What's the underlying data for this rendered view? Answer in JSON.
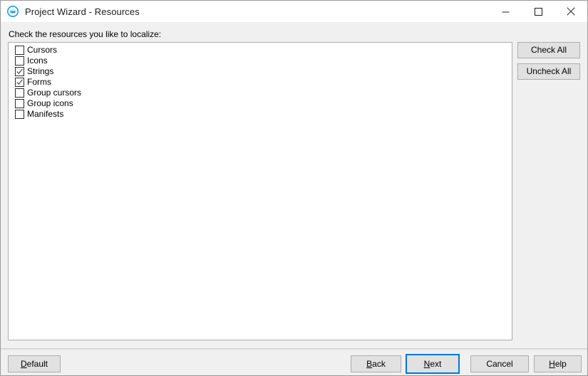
{
  "window": {
    "title": "Project Wizard - Resources",
    "icon": "project-wizard-icon",
    "controls": {
      "minimize": "minimize-icon",
      "maximize": "maximize-icon",
      "close": "close-icon"
    }
  },
  "colors": {
    "accent": "#0078d7",
    "window_body": "#f0f0f0",
    "titlebar": "#ffffff",
    "button_face": "#e1e1e1",
    "button_border": "#adadad",
    "listbox_border": "#adadad",
    "text": "#000000"
  },
  "main": {
    "instruction": "Check the resources you like to localize:",
    "resources": [
      {
        "label": "Cursors",
        "checked": false
      },
      {
        "label": "Icons",
        "checked": false
      },
      {
        "label": "Strings",
        "checked": true
      },
      {
        "label": "Forms",
        "checked": true
      },
      {
        "label": "Group cursors",
        "checked": false
      },
      {
        "label": "Group icons",
        "checked": false
      },
      {
        "label": "Manifests",
        "checked": false
      }
    ]
  },
  "side_buttons": [
    {
      "label": "Check All",
      "name": "check-all-button"
    },
    {
      "label": "Uncheck All",
      "name": "uncheck-all-button"
    }
  ],
  "footer": {
    "default": {
      "pre": "",
      "mnemonic": "D",
      "post": "efault"
    },
    "back": {
      "pre": "",
      "mnemonic": "B",
      "post": "ack"
    },
    "next": {
      "pre": "",
      "mnemonic": "N",
      "post": "ext"
    },
    "cancel": {
      "pre": "Cancel",
      "mnemonic": "",
      "post": ""
    },
    "help": {
      "pre": "",
      "mnemonic": "H",
      "post": "elp"
    },
    "focused_button": "next"
  }
}
